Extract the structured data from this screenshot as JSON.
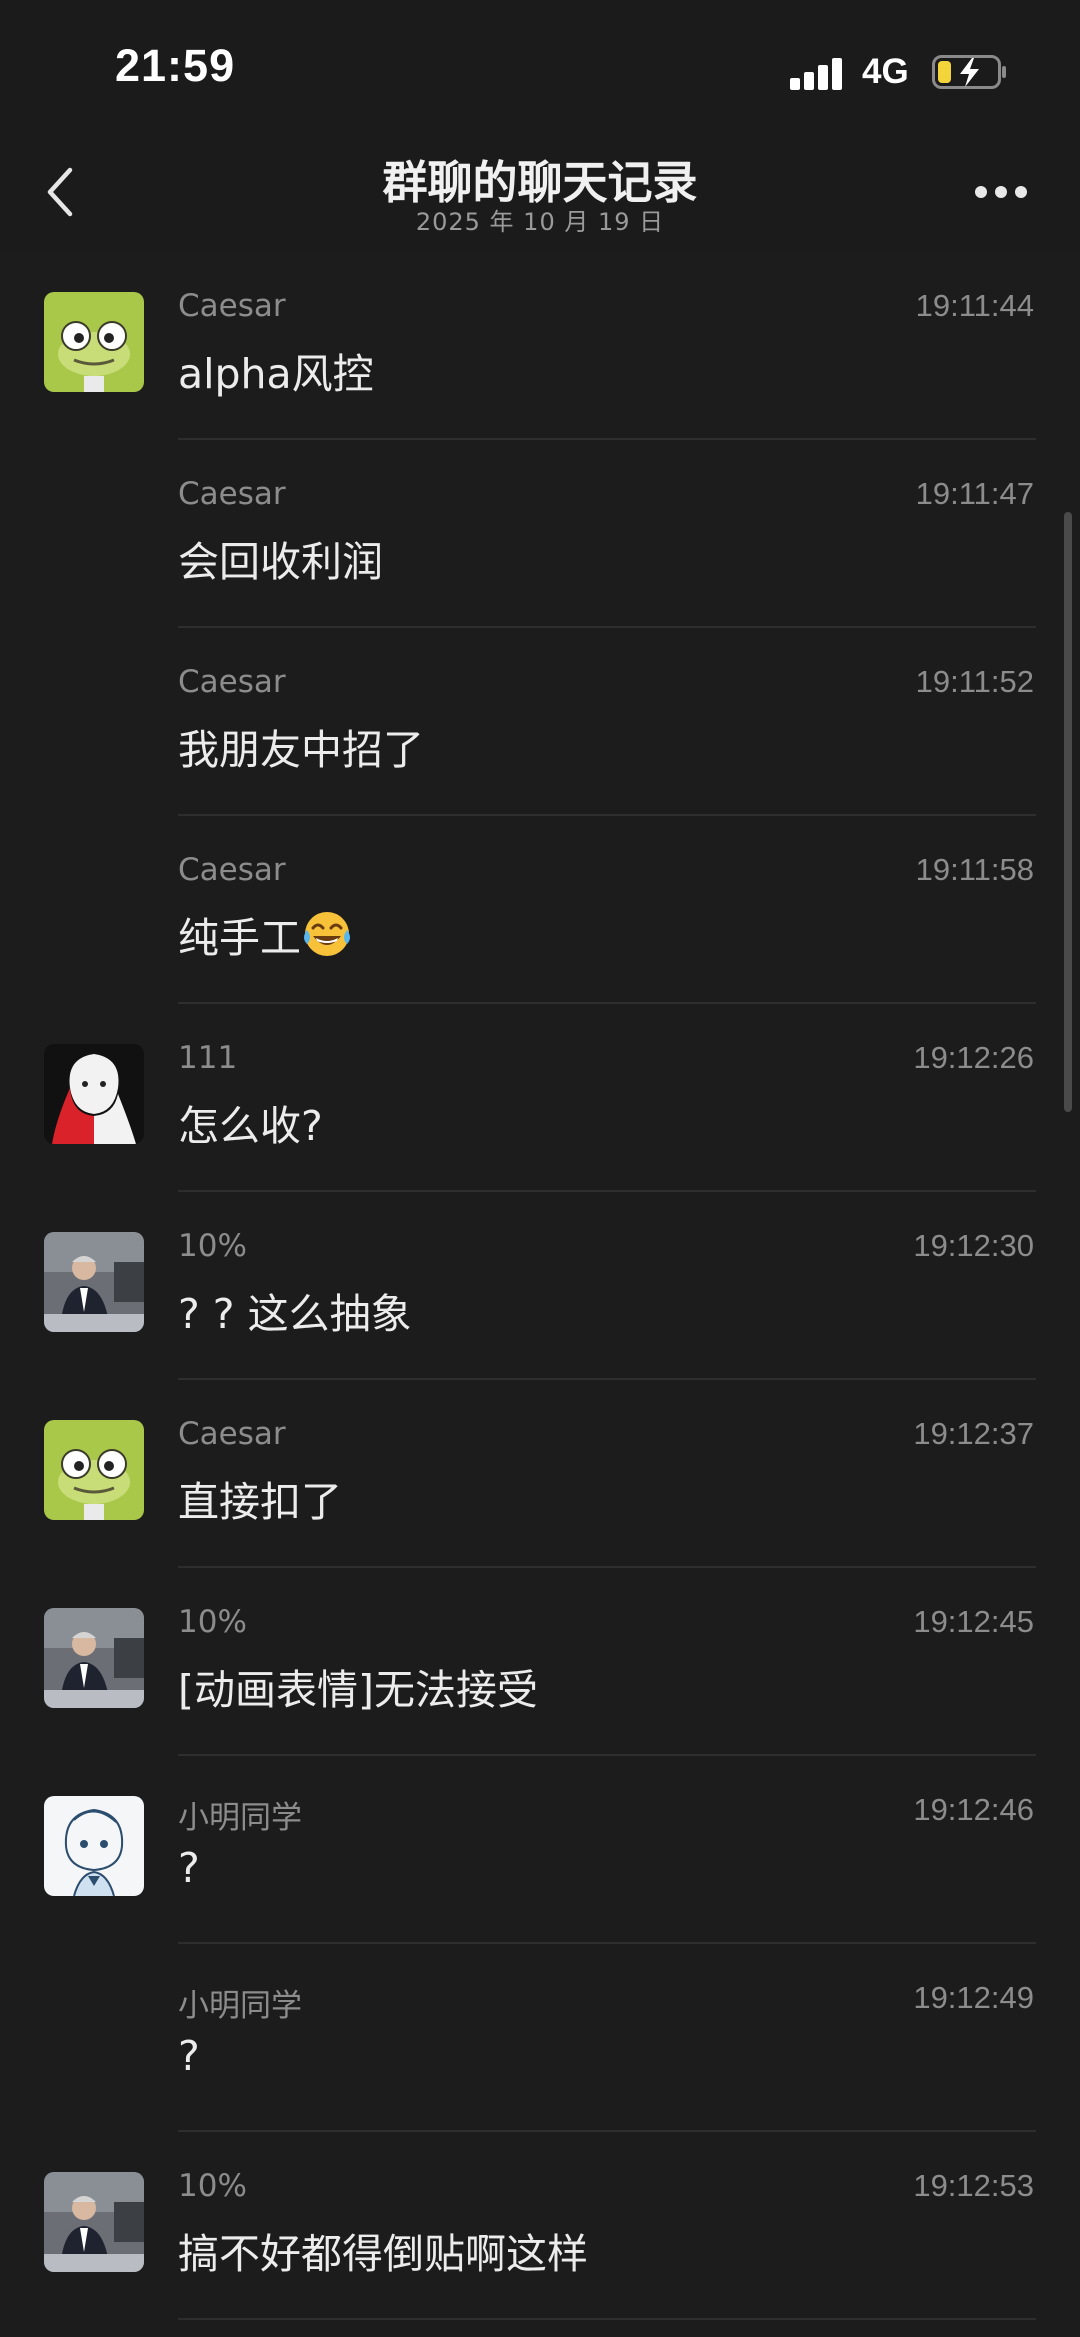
{
  "status_bar": {
    "time": "21:59",
    "network": "4G"
  },
  "nav": {
    "title": "群聊的聊天记录",
    "date": "2025 年 10 月 19 日"
  },
  "messages": [
    {
      "sender": "Caesar",
      "time": "19:11:44",
      "text": "alpha风控",
      "avatar": "frog-avatar",
      "show_avatar": true
    },
    {
      "sender": "Caesar",
      "time": "19:11:47",
      "text": "会回收利润",
      "show_avatar": false
    },
    {
      "sender": "Caesar",
      "time": "19:11:52",
      "text": "我朋友中招了",
      "show_avatar": false
    },
    {
      "sender": "Caesar",
      "time": "19:11:58",
      "text": "纯手工",
      "emoji": "tears-of-joy-emoji",
      "show_avatar": false
    },
    {
      "sender": "111",
      "time": "19:12:26",
      "text": "怎么收?",
      "avatar": "anime-redwhite-avatar",
      "show_avatar": true
    },
    {
      "sender": "10%",
      "time": "19:12:30",
      "text": "? ?  这么抽象",
      "avatar": "man-at-desk-avatar",
      "show_avatar": true
    },
    {
      "sender": "Caesar",
      "time": "19:12:37",
      "text": "直接扣了",
      "avatar": "frog-avatar",
      "show_avatar": true
    },
    {
      "sender": "10%",
      "time": "19:12:45",
      "text": "[动画表情]无法接受",
      "avatar": "man-at-desk-avatar",
      "show_avatar": true
    },
    {
      "sender": "小明同学",
      "time": "19:12:46",
      "text": "?",
      "avatar": "anime-girl-sketch-avatar",
      "show_avatar": true
    },
    {
      "sender": "小明同学",
      "time": "19:12:49",
      "text": "?",
      "show_avatar": false
    },
    {
      "sender": "10%",
      "time": "19:12:53",
      "text": "搞不好都得倒贴啊这样",
      "avatar": "man-at-desk-avatar",
      "show_avatar": true
    }
  ],
  "colors": {
    "background": "#1c1c1c",
    "meta_text": "#8c8c8c",
    "body_text": "#ececec",
    "avatar_frog": "#a9c84a"
  }
}
